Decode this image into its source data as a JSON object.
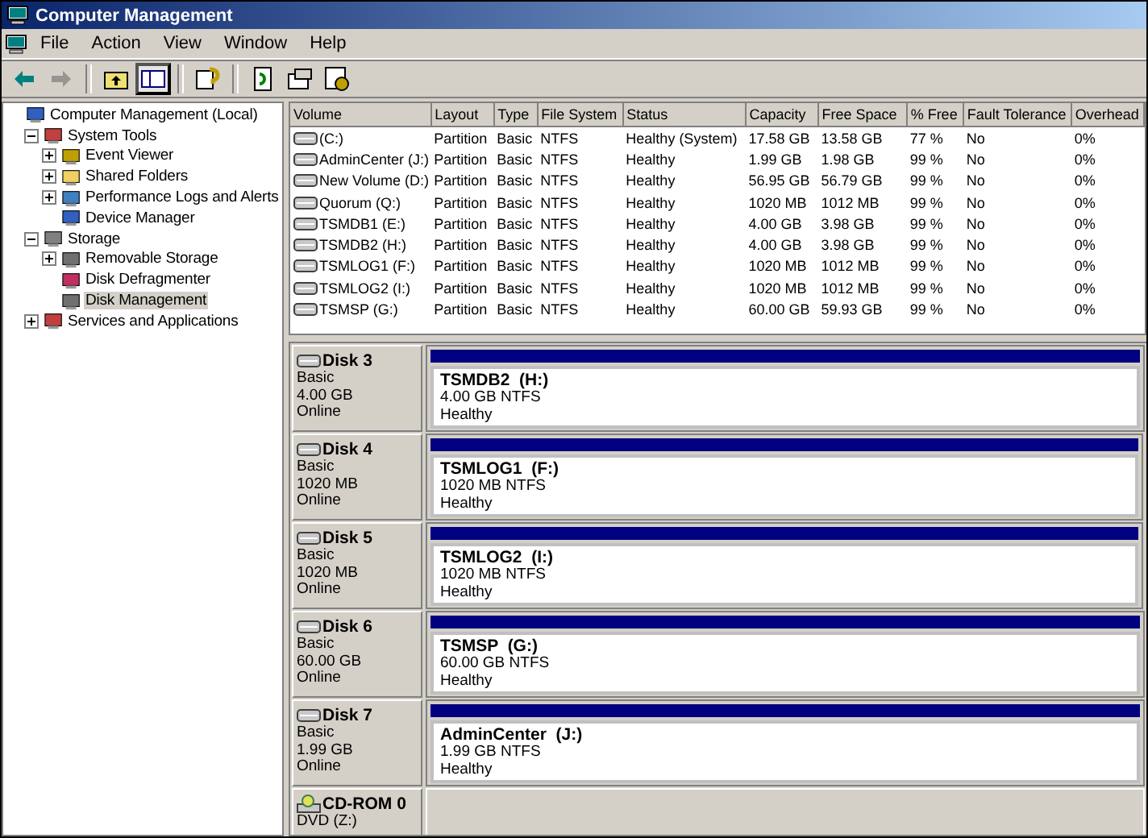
{
  "window": {
    "title": "Computer Management"
  },
  "menu": [
    "File",
    "Action",
    "View",
    "Window",
    "Help"
  ],
  "toolbar": [
    {
      "kind": "back",
      "disabled": false,
      "pressed": false
    },
    {
      "kind": "forward",
      "disabled": true,
      "pressed": false
    },
    {
      "kind": "sep"
    },
    {
      "kind": "up",
      "disabled": false,
      "pressed": false
    },
    {
      "kind": "tree",
      "disabled": false,
      "pressed": true
    },
    {
      "kind": "sep"
    },
    {
      "kind": "help",
      "disabled": false,
      "pressed": false
    },
    {
      "kind": "sep"
    },
    {
      "kind": "refresh",
      "disabled": false,
      "pressed": false
    },
    {
      "kind": "props",
      "disabled": false,
      "pressed": false
    },
    {
      "kind": "settings",
      "disabled": false,
      "pressed": false
    }
  ],
  "tree": {
    "label": "Computer Management (Local)",
    "selected": false,
    "children": [
      {
        "label": "System Tools",
        "expanded": true,
        "selected": false,
        "children": [
          {
            "label": "Event Viewer",
            "expanded": false,
            "selected": false
          },
          {
            "label": "Shared Folders",
            "expanded": false,
            "selected": false
          },
          {
            "label": "Performance Logs and Alerts",
            "expanded": false,
            "selected": false
          },
          {
            "label": "Device Manager",
            "selected": false
          }
        ]
      },
      {
        "label": "Storage",
        "expanded": true,
        "selected": false,
        "children": [
          {
            "label": "Removable Storage",
            "expanded": false,
            "selected": false
          },
          {
            "label": "Disk Defragmenter",
            "selected": false
          },
          {
            "label": "Disk Management",
            "selected": true
          }
        ]
      },
      {
        "label": "Services and Applications",
        "expanded": false,
        "selected": false
      }
    ]
  },
  "table": {
    "columns": [
      "Volume",
      "Layout",
      "Type",
      "File System",
      "Status",
      "Capacity",
      "Free Space",
      "% Free",
      "Fault Tolerance",
      "Overhead"
    ],
    "rows": [
      [
        "(C:)",
        "Partition",
        "Basic",
        "NTFS",
        "Healthy (System)",
        "17.58 GB",
        "13.58 GB",
        "77 %",
        "No",
        "0%"
      ],
      [
        "AdminCenter (J:)",
        "Partition",
        "Basic",
        "NTFS",
        "Healthy",
        "1.99 GB",
        "1.98 GB",
        "99 %",
        "No",
        "0%"
      ],
      [
        "New Volume (D:)",
        "Partition",
        "Basic",
        "NTFS",
        "Healthy",
        "56.95 GB",
        "56.79 GB",
        "99 %",
        "No",
        "0%"
      ],
      [
        "Quorum (Q:)",
        "Partition",
        "Basic",
        "NTFS",
        "Healthy",
        "1020 MB",
        "1012 MB",
        "99 %",
        "No",
        "0%"
      ],
      [
        "TSMDB1 (E:)",
        "Partition",
        "Basic",
        "NTFS",
        "Healthy",
        "4.00 GB",
        "3.98 GB",
        "99 %",
        "No",
        "0%"
      ],
      [
        "TSMDB2 (H:)",
        "Partition",
        "Basic",
        "NTFS",
        "Healthy",
        "4.00 GB",
        "3.98 GB",
        "99 %",
        "No",
        "0%"
      ],
      [
        "TSMLOG1 (F:)",
        "Partition",
        "Basic",
        "NTFS",
        "Healthy",
        "1020 MB",
        "1012 MB",
        "99 %",
        "No",
        "0%"
      ],
      [
        "TSMLOG2 (I:)",
        "Partition",
        "Basic",
        "NTFS",
        "Healthy",
        "1020 MB",
        "1012 MB",
        "99 %",
        "No",
        "0%"
      ],
      [
        "TSMSP (G:)",
        "Partition",
        "Basic",
        "NTFS",
        "Healthy",
        "60.00 GB",
        "59.93 GB",
        "99 %",
        "No",
        "0%"
      ]
    ]
  },
  "disks": [
    {
      "kind": "disk",
      "name": "Disk 3",
      "info": [
        "Basic",
        "4.00 GB",
        "Online"
      ],
      "partition": {
        "name": "TSMDB2  (H:)",
        "size": "4.00 GB NTFS",
        "status": "Healthy"
      }
    },
    {
      "kind": "disk",
      "name": "Disk 4",
      "info": [
        "Basic",
        "1020 MB",
        "Online"
      ],
      "partition": {
        "name": "TSMLOG1  (F:)",
        "size": "1020 MB NTFS",
        "status": "Healthy"
      }
    },
    {
      "kind": "disk",
      "name": "Disk 5",
      "info": [
        "Basic",
        "1020 MB",
        "Online"
      ],
      "partition": {
        "name": "TSMLOG2  (I:)",
        "size": "1020 MB NTFS",
        "status": "Healthy"
      }
    },
    {
      "kind": "disk",
      "name": "Disk 6",
      "info": [
        "Basic",
        "60.00 GB",
        "Online"
      ],
      "partition": {
        "name": "TSMSP  (G:)",
        "size": "60.00 GB NTFS",
        "status": "Healthy"
      }
    },
    {
      "kind": "disk",
      "name": "Disk 7",
      "info": [
        "Basic",
        "1.99 GB",
        "Online"
      ],
      "partition": {
        "name": "AdminCenter  (J:)",
        "size": "1.99 GB NTFS",
        "status": "Healthy"
      }
    },
    {
      "kind": "cdrom",
      "name": "CD-ROM 0",
      "info": [
        "DVD (Z:)"
      ]
    }
  ]
}
